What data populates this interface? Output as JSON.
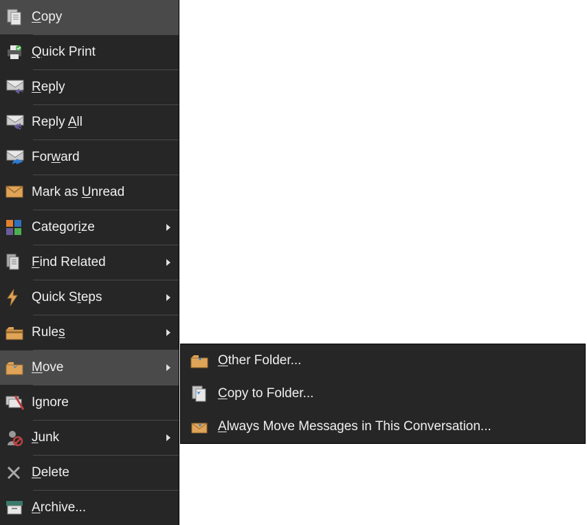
{
  "menu": {
    "items": [
      {
        "id": "copy",
        "prefix": "",
        "u": "C",
        "suffix": "opy",
        "icon": "copy",
        "arrow": false
      },
      {
        "id": "quick-print",
        "prefix": "",
        "u": "Q",
        "suffix": "uick Print",
        "icon": "print",
        "arrow": false,
        "sep_after": true
      },
      {
        "id": "reply",
        "prefix": "",
        "u": "R",
        "suffix": "eply",
        "icon": "reply",
        "arrow": false
      },
      {
        "id": "reply-all",
        "prefix": "Reply ",
        "u": "A",
        "suffix": "ll",
        "icon": "reply-all",
        "arrow": false
      },
      {
        "id": "forward",
        "prefix": "For",
        "u": "w",
        "suffix": "ard",
        "icon": "forward",
        "arrow": false,
        "sep_after": true
      },
      {
        "id": "mark-unread",
        "prefix": "Mark as ",
        "u": "U",
        "suffix": "nread",
        "icon": "mail",
        "arrow": false
      },
      {
        "id": "categorize",
        "prefix": "Categor",
        "u": "i",
        "suffix": "ze",
        "icon": "categorize",
        "arrow": true,
        "sep_after": true
      },
      {
        "id": "find-related",
        "prefix": "",
        "u": "F",
        "suffix": "ind Related",
        "icon": "find",
        "arrow": true
      },
      {
        "id": "quick-steps",
        "prefix": "Quick S",
        "u": "t",
        "suffix": "eps",
        "icon": "bolt",
        "arrow": true
      },
      {
        "id": "rules",
        "prefix": "Rule",
        "u": "s",
        "suffix": "",
        "icon": "rules",
        "arrow": true
      },
      {
        "id": "move",
        "prefix": "",
        "u": "M",
        "suffix": "ove",
        "icon": "move",
        "arrow": true,
        "active": true
      },
      {
        "id": "ignore",
        "prefix": "I",
        "u": "g",
        "suffix": "nore",
        "icon": "ignore",
        "arrow": false
      },
      {
        "id": "junk",
        "prefix": "",
        "u": "J",
        "suffix": "unk",
        "icon": "junk",
        "arrow": true,
        "sep_after": true
      },
      {
        "id": "delete",
        "prefix": "",
        "u": "D",
        "suffix": "elete",
        "icon": "delete",
        "arrow": false
      },
      {
        "id": "archive",
        "prefix": "",
        "u": "A",
        "suffix": "rchive...",
        "icon": "archive",
        "arrow": false
      }
    ]
  },
  "submenu": {
    "items": [
      {
        "id": "other-folder",
        "prefix": "",
        "u": "O",
        "suffix": "ther Folder...",
        "icon": "move"
      },
      {
        "id": "copy-to-folder",
        "prefix": "",
        "u": "C",
        "suffix": "opy to Folder...",
        "icon": "copy-folder"
      },
      {
        "id": "always-move",
        "prefix": "",
        "u": "A",
        "suffix": "lways Move Messages in This Conversation...",
        "icon": "mail-move"
      }
    ]
  }
}
